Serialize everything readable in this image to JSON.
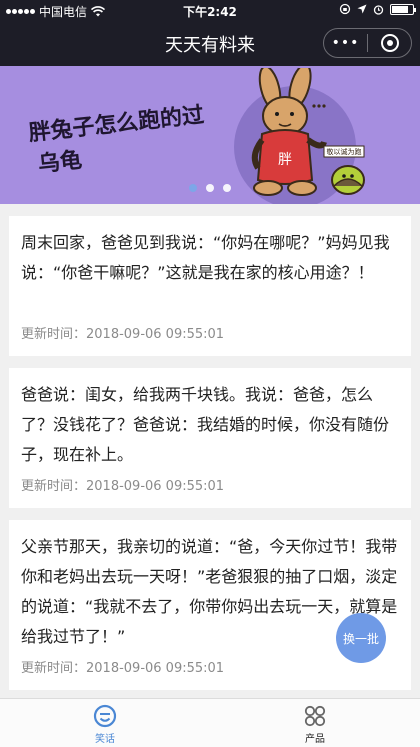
{
  "status_bar": {
    "carrier": "中国电信",
    "time": "下午2:42"
  },
  "navbar": {
    "title": "天天有料来",
    "more_icon": "more-dots-icon",
    "close_icon": "target-ring-icon"
  },
  "banner": {
    "caption_line1": "胖兔子怎么跑的过",
    "caption_line2": "乌龟",
    "shirt_text": "胖",
    "sign_text": "敬以诚为跑",
    "slide_count": 3,
    "active_slide": 1
  },
  "jokes": [
    {
      "text": "周末回家，爸爸见到我说：“你妈在哪呢？”妈妈见我说：“你爸干嘛呢？”这就是我在家的核心用途？！",
      "meta": "更新时间：2018-09-06 09:55:01"
    },
    {
      "text": "爸爸说：闺女，给我两千块钱。我说：爸爸，怎么了？没钱花了？爸爸说：我结婚的时候，你没有随份子，现在补上。",
      "meta": "更新时间：2018-09-06 09:55:01"
    },
    {
      "text": "父亲节那天，我亲切的说道：“爸，今天你过节！我带你和老妈出去玩一天呀！”老爸狠狠的抽了口烟，淡定的说道：“我就不去了，你带你妈出去玩一天，就算是给我过节了！”",
      "meta": "更新时间：2018-09-06 09:55:01"
    }
  ],
  "fab": {
    "label": "换一批"
  },
  "tabbar": {
    "tabs": [
      {
        "label": "笑话",
        "icon": "smiley-icon",
        "active": true
      },
      {
        "label": "产品",
        "icon": "grid-icon",
        "active": false
      }
    ]
  },
  "colors": {
    "header_bg": "#1d1d27",
    "banner_bg": "#a68ee0",
    "accent": "#6f9ae6",
    "tab_active": "#4a87d4"
  }
}
